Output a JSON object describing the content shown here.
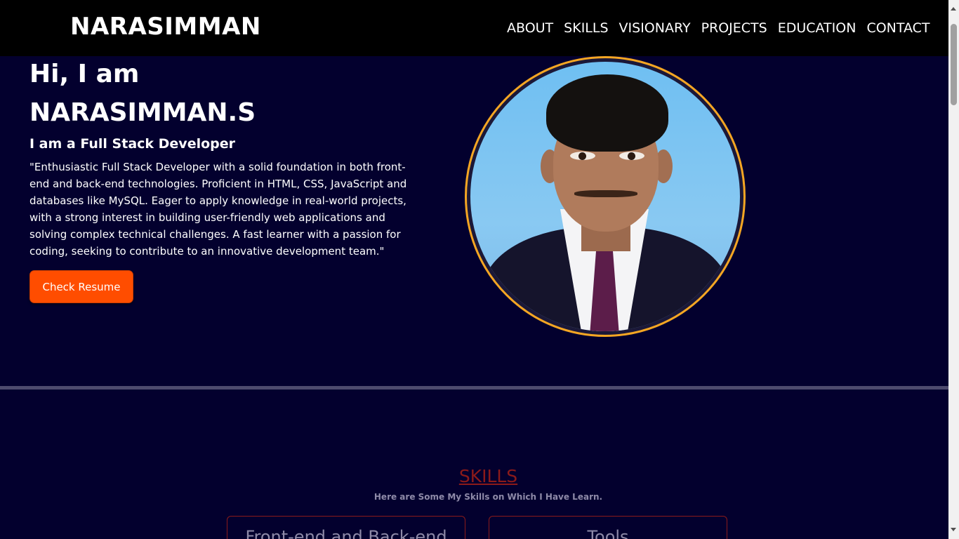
{
  "nav": {
    "brand": "NARASIMMAN",
    "links": [
      "ABOUT",
      "SKILLS",
      "VISIONARY",
      "PROJECTS",
      "EDUCATION",
      "CONTACT"
    ]
  },
  "hero": {
    "greeting": "Hi, I am",
    "name": "NARASIMMAN.S",
    "role": "I am a Full Stack Developer",
    "description": "\"Enthusiastic Full Stack Developer with a solid foundation in both front-end and back-end technologies. Proficient in HTML, CSS, JavaScript and databases like MySQL. Eager to apply knowledge in real-world projects, with a strong interest in building user-friendly web applications and solving complex technical challenges. A fast learner with a passion for coding, seeking to contribute to an innovative development team.\"",
    "resume_button": "Check Resume"
  },
  "skills": {
    "title": "SKILLS",
    "subtitle": "Here are Some My Skills on Which I Have Learn.",
    "cards": [
      "Front-end and Back-end",
      "Tools"
    ]
  },
  "colors": {
    "background": "#03002e",
    "navbar": "#000000",
    "accent_button": "#ff4d00",
    "portrait_border": "#f5a623",
    "skills_title": "#8b1a1a"
  }
}
